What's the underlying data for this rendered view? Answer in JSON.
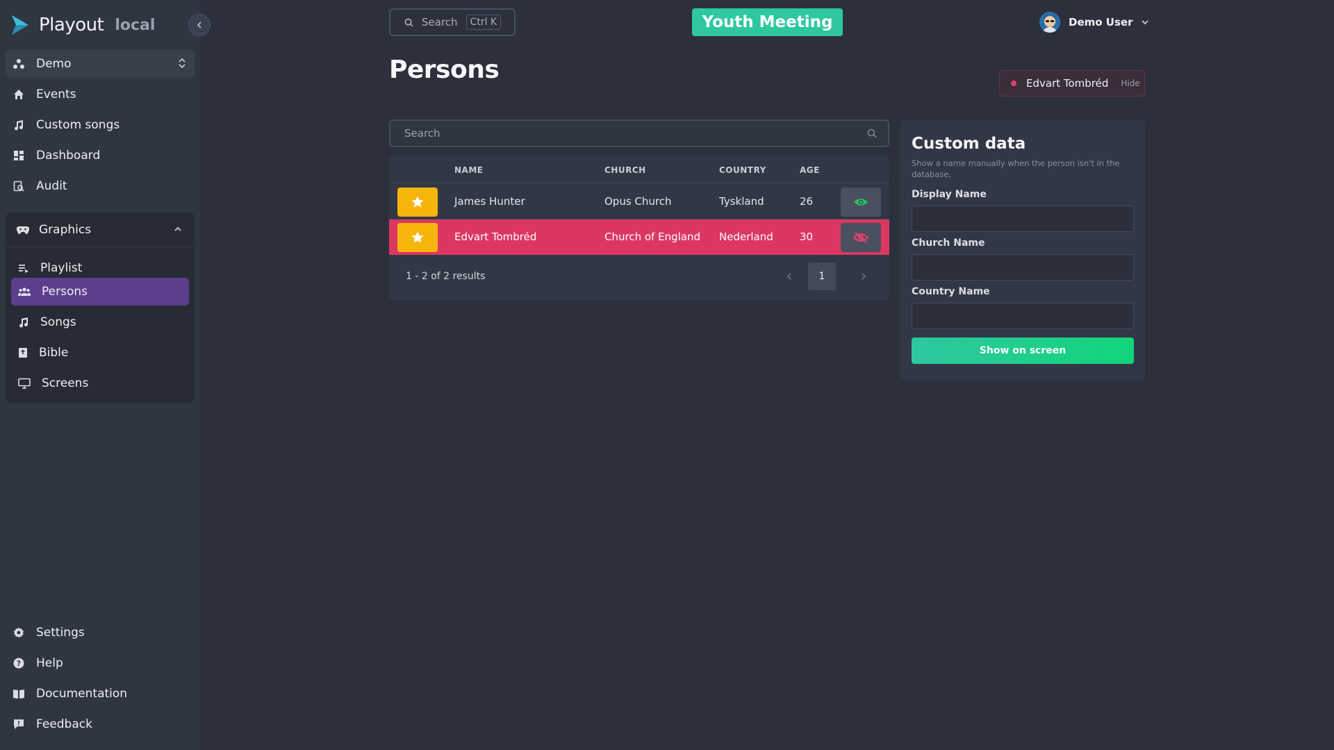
{
  "brand": {
    "name": "Playout",
    "env": "local"
  },
  "sidebar": {
    "workspace": "Demo",
    "items": [
      {
        "label": "Events",
        "icon": "home-icon"
      },
      {
        "label": "Custom songs",
        "icon": "music-note-icon"
      },
      {
        "label": "Dashboard",
        "icon": "dashboard-icon"
      },
      {
        "label": "Audit",
        "icon": "audit-icon"
      }
    ],
    "graphics": {
      "label": "Graphics",
      "items": [
        {
          "label": "Playlist",
          "icon": "playlist-icon"
        },
        {
          "label": "Persons",
          "icon": "people-icon",
          "active": true
        },
        {
          "label": "Songs",
          "icon": "music-note-icon"
        },
        {
          "label": "Bible",
          "icon": "bible-icon"
        },
        {
          "label": "Screens",
          "icon": "monitor-icon"
        }
      ]
    },
    "bottom": [
      {
        "label": "Settings",
        "icon": "gear-icon"
      },
      {
        "label": "Help",
        "icon": "help-icon"
      },
      {
        "label": "Documentation",
        "icon": "book-icon"
      },
      {
        "label": "Feedback",
        "icon": "feedback-icon"
      }
    ]
  },
  "topbar": {
    "search_label": "Search",
    "search_shortcut": "Ctrl K",
    "event": "Youth Meeting",
    "user": "Demo User"
  },
  "page": {
    "title": "Persons"
  },
  "live": {
    "name": "Edvart Tombréd",
    "hide_label": "Hide"
  },
  "table": {
    "search_placeholder": "Search",
    "columns": [
      "NAME",
      "CHURCH",
      "COUNTRY",
      "AGE"
    ],
    "rows": [
      {
        "name": "James Hunter",
        "church": "Opus Church",
        "country": "Tyskland",
        "age": "26",
        "live": false
      },
      {
        "name": "Edvart Tombréd",
        "church": "Church of England",
        "country": "Nederland",
        "age": "30",
        "live": true
      }
    ],
    "results": "1 - 2 of 2 results",
    "page": "1"
  },
  "custom": {
    "title": "Custom data",
    "description": "Show a name manually when the person isn't in the database.",
    "display_label": "Display Name",
    "church_label": "Church Name",
    "country_label": "Country Name",
    "button": "Show on screen"
  },
  "colors": {
    "accent_purple": "#5b3f8c",
    "live_red": "#dc3762",
    "teal": "#2ec7a0",
    "star_yellow": "#f5b50a"
  }
}
